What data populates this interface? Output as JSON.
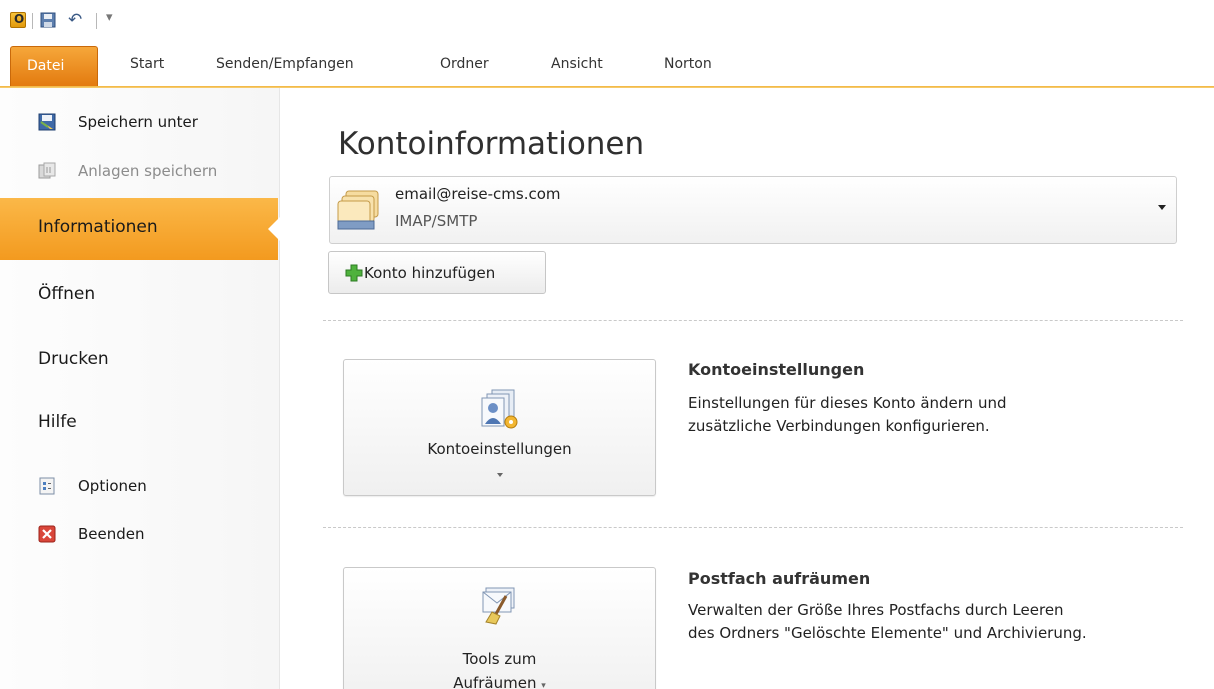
{
  "qat": {
    "app_icon": "outlook-icon",
    "save_icon": "save-icon",
    "undo_icon": "undo-icon",
    "customize_icon": "customize-qat-icon"
  },
  "ribbon": {
    "tabs": [
      "Datei",
      "Start",
      "Senden/Empfangen",
      "Ordner",
      "Ansicht",
      "Norton"
    ],
    "active_tab": "Datei",
    "accent_color": "#f39a1f"
  },
  "backstage_nav": {
    "save_as": "Speichern unter",
    "save_attachments": "Anlagen speichern",
    "info": "Informationen",
    "open": "Öffnen",
    "print": "Drucken",
    "help": "Hilfe",
    "options": "Optionen",
    "exit": "Beenden"
  },
  "main": {
    "title": "Kontoinformationen",
    "account": {
      "email": "email@reise-cms.com",
      "type": "IMAP/SMTP"
    },
    "add_account_label": "Konto hinzufügen",
    "account_settings": {
      "button_label": "Kontoeinstellungen",
      "title": "Kontoeinstellungen",
      "desc_line1": "Einstellungen für dieses Konto ändern und",
      "desc_line2": "zusätzliche Verbindungen konfigurieren."
    },
    "cleanup": {
      "button_label_line1": "Tools zum",
      "button_label_line2": "Aufräumen",
      "title": "Postfach aufräumen",
      "desc_line1": "Verwalten der Größe Ihres Postfachs durch Leeren",
      "desc_line2": "des Ordners \"Gelöschte Elemente\" und Archivierung."
    }
  }
}
